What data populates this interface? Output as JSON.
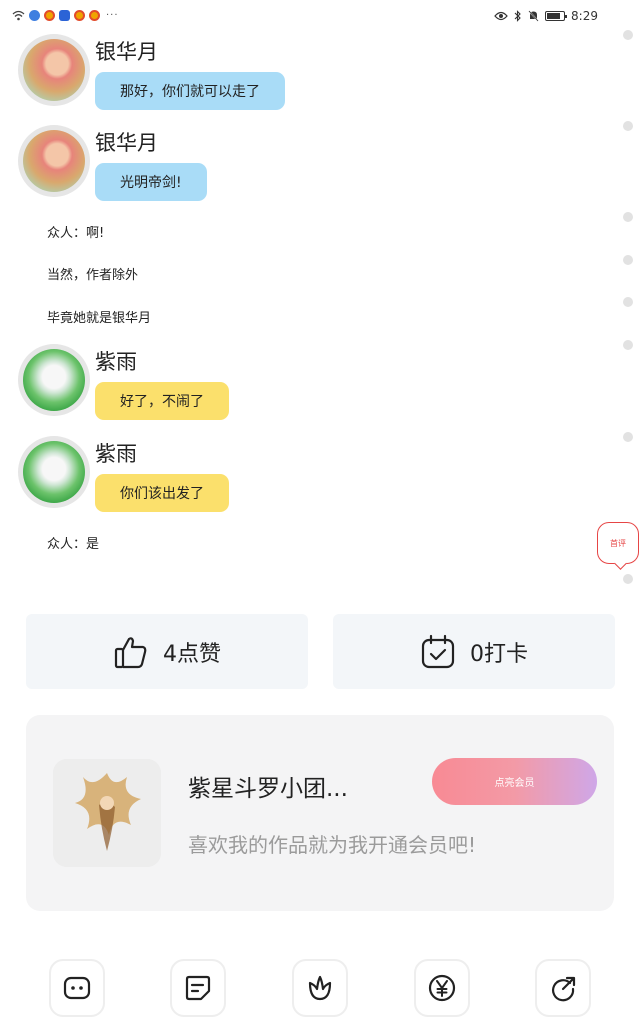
{
  "status_bar": {
    "overflow_dots": "···",
    "time": "8:29",
    "battery_level": 0.8,
    "icons": [
      "wifi-icon",
      "app-icon",
      "weibo-icon",
      "vpn-icon",
      "weibo-icon",
      "weibo-icon",
      "eye-icon",
      "bluetooth-icon",
      "mute-icon",
      "battery-icon"
    ]
  },
  "chat": {
    "messages": [
      {
        "speaker": "银华月",
        "text": "那好，你们就可以走了",
        "color": "#a9dcf7"
      },
      {
        "speaker": "银华月",
        "text": "光明帝剑!",
        "color": "#a9dcf7"
      },
      {
        "speaker": "紫雨",
        "text": "好了，不闹了",
        "color": "#fbe06c"
      },
      {
        "speaker": "紫雨",
        "text": "你们该出发了",
        "color": "#fbe06c"
      }
    ],
    "narration": [
      "众人：啊!",
      "当然，作者除外",
      "毕竟她就是银华月",
      "众人：是"
    ]
  },
  "comment_badge": "首评",
  "actions": {
    "like": {
      "label": "4点赞",
      "icon": "thumbs-up-icon"
    },
    "checkin": {
      "label": "0打卡",
      "icon": "calendar-check-icon"
    }
  },
  "member_card": {
    "title": "紫星斗罗小团...",
    "subtitle": "喜欢我的作品就为我开通会员吧!",
    "button": "点亮会员",
    "button_gradient": [
      "#f88a94",
      "#cfa7e8"
    ]
  },
  "bottom_bar": {
    "icons": [
      "comment-icon",
      "note-icon",
      "flower-icon",
      "yen-icon",
      "share-icon"
    ]
  },
  "colors": {
    "accent_red": "#e64545",
    "bubble_blue": "#a9dcf7",
    "bubble_yellow": "#fbe06c"
  }
}
